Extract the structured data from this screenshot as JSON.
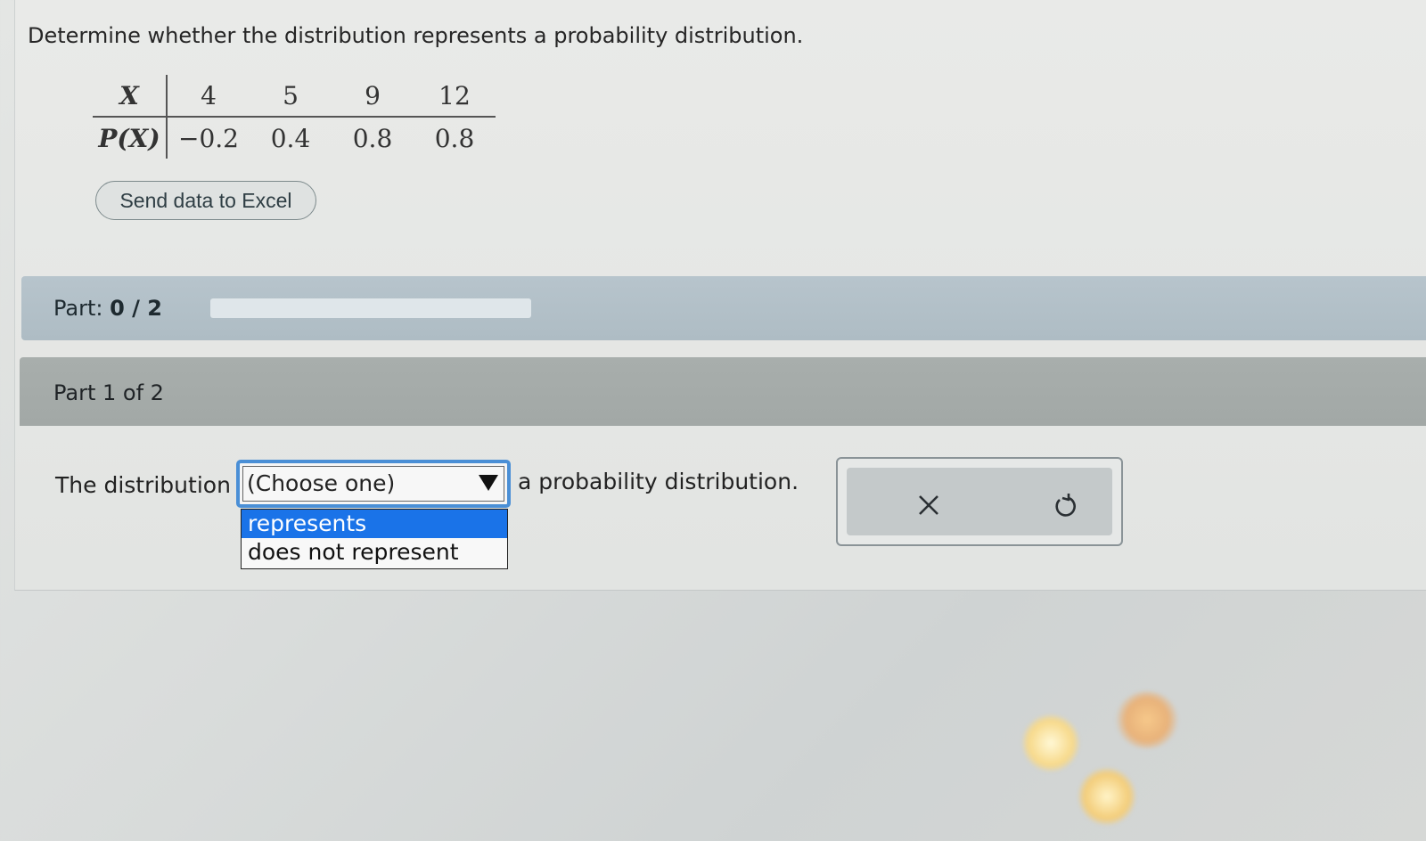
{
  "question": {
    "text": "Determine whether the distribution represents a probability distribution."
  },
  "table": {
    "header_x": "X",
    "header_px": "P(X)",
    "x_values": [
      "4",
      "5",
      "9",
      "12"
    ],
    "p_values": [
      "−0.2",
      "0.4",
      "0.8",
      "0.8"
    ]
  },
  "excel_button": {
    "label": "Send data to Excel"
  },
  "progress": {
    "label_prefix": "Part: ",
    "value_text": "0 / 2",
    "completed": 0,
    "total": 2
  },
  "part": {
    "label": "Part 1 of 2"
  },
  "answer": {
    "prefix": "The distribution",
    "select_value": "(Choose one)",
    "options": [
      "represents",
      "does not represent"
    ],
    "highlighted_option": "represents",
    "suffix": "a probability distribution."
  },
  "actions": {
    "clear_icon": "close-icon",
    "undo_icon": "undo-icon"
  },
  "colors": {
    "select_focus": "#4a8fd6",
    "option_highlight": "#1a73e8",
    "part_bar": "#b7c4cc",
    "part1_bar": "#a8aeac"
  }
}
